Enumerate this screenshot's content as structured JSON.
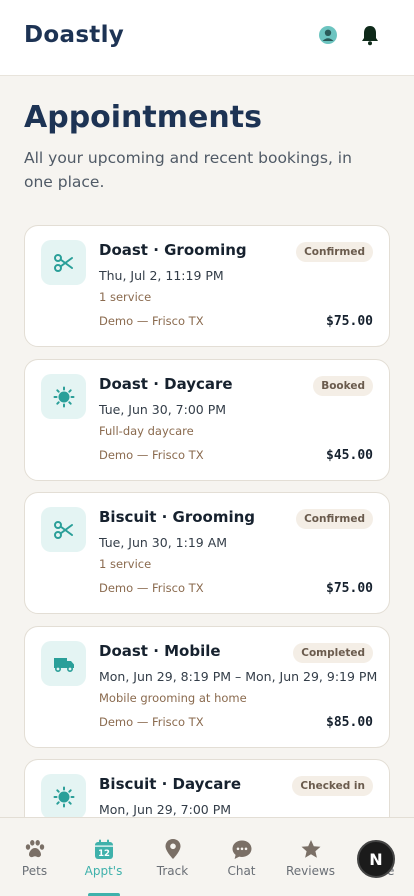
{
  "app": {
    "title": "Doastly"
  },
  "header": {
    "profile_icon": "profile-icon",
    "bell_icon": "bell-icon"
  },
  "page": {
    "title": "Appointments",
    "subtitle": "All your upcoming and recent bookings, in one place."
  },
  "appointments": [
    {
      "title": "Doast · Grooming",
      "time": "Thu, Jul 2, 11:19 PM",
      "summary": "1 service",
      "location": "Demo — Frisco TX",
      "price": "$75.00",
      "status": "Confirmed",
      "icon": "scissors-icon"
    },
    {
      "title": "Doast · Daycare",
      "time": "Tue, Jun 30, 7:00 PM",
      "summary": "Full-day daycare",
      "location": "Demo — Frisco TX",
      "price": "$45.00",
      "status": "Booked",
      "icon": "sun-icon"
    },
    {
      "title": "Biscuit · Grooming",
      "time": "Tue, Jun 30, 1:19 AM",
      "summary": "1 service",
      "location": "Demo — Frisco TX",
      "price": "$75.00",
      "status": "Confirmed",
      "icon": "scissors-icon"
    },
    {
      "title": "Doast · Mobile",
      "time": "Mon, Jun 29, 8:19 PM – Mon, Jun 29, 9:19 PM",
      "summary": "Mobile grooming at home",
      "location": "Demo — Frisco TX",
      "price": "$85.00",
      "status": "Completed",
      "icon": "van-icon"
    },
    {
      "title": "Biscuit · Daycare",
      "time": "Mon, Jun 29, 7:00 PM",
      "summary": "",
      "location": "",
      "price": "",
      "status": "Checked in",
      "icon": "sun-icon"
    }
  ],
  "tabs": [
    {
      "label": "Pets",
      "icon": "paw-icon"
    },
    {
      "label": "Appt's",
      "icon": "calendar-icon",
      "day": "12",
      "active": true
    },
    {
      "label": "Track",
      "icon": "location-pin-icon"
    },
    {
      "label": "Chat",
      "icon": "chat-bubble-icon"
    },
    {
      "label": "Reviews",
      "icon": "star-icon"
    },
    {
      "label": "More",
      "icon": "more-icon"
    }
  ],
  "fab": {
    "letter": "N"
  },
  "colors": {
    "accent": "#3fb1ab",
    "brand": "#1d3354",
    "background": "#f6f4f0"
  }
}
